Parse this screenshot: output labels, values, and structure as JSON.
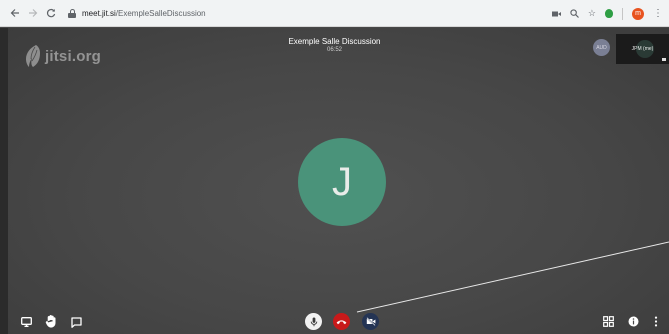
{
  "browser": {
    "back_icon": "arrow-left-icon",
    "forward_icon": "arrow-right-icon",
    "reload_icon": "reload-icon",
    "url_host": "meet.jit.si",
    "url_path": "/ExempleSalleDiscussion",
    "profile_initial": "m",
    "colors": {
      "bar": "#f1f3f4",
      "profile": "#e8531f",
      "extension": "#2e9e44"
    }
  },
  "meeting": {
    "watermark": "jitsi.org",
    "title": "Exemple Salle Discussion",
    "timer": "06:52",
    "main_avatar_initial": "J",
    "participant_avatar": "AUD",
    "self_view_label": "JPM (me)",
    "colors": {
      "main_avatar": "#4a937a",
      "hangup": "#c8191a",
      "video_muted": "#243454",
      "background": "#474747"
    }
  },
  "toolbar": {
    "left": [
      "screen-share-icon",
      "raise-hand-icon",
      "chat-icon"
    ],
    "center": [
      "microphone-icon",
      "hangup-icon",
      "video-off-icon"
    ],
    "right": [
      "tile-view-icon",
      "info-icon",
      "more-icon"
    ]
  }
}
